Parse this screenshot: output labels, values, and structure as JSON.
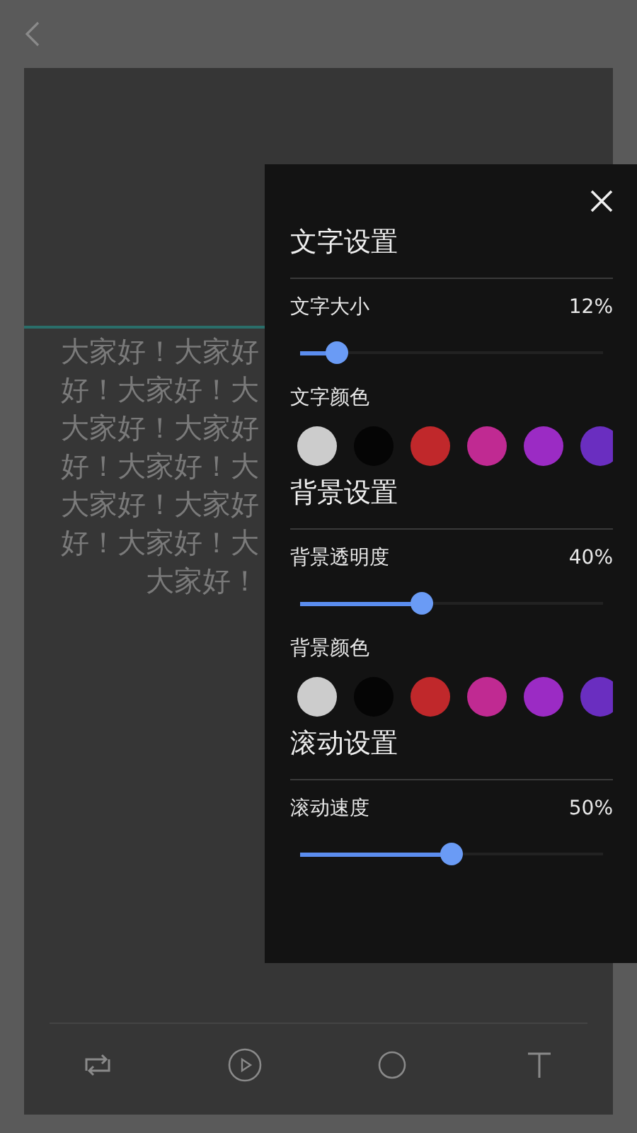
{
  "marquee": {
    "lines": [
      "大家好！大家好",
      "好！大家好！大",
      "大家好！大家好",
      "好！大家好！大",
      "大家好！大家好",
      "好！大家好！大",
      "大家好！"
    ]
  },
  "settings_panel": {
    "sections": [
      {
        "title": "文字设置",
        "rows": [
          {
            "kind": "slider",
            "label": "文字大小",
            "reading": "12%",
            "level": 0.12
          },
          {
            "kind": "swatches",
            "label": "文字颜色",
            "swatches": [
              {
                "color": "#cccccc"
              },
              {
                "color": "#050505"
              },
              {
                "color": "#c0282b"
              },
              {
                "color": "#c02a92"
              },
              {
                "color": "#9b2bc4"
              },
              {
                "color": "#6a2ec0"
              }
            ]
          }
        ]
      },
      {
        "title": "背景设置",
        "rows": [
          {
            "kind": "slider",
            "label": "背景透明度",
            "reading": "40%",
            "level": 0.4
          },
          {
            "kind": "swatches",
            "label": "背景颜色",
            "swatches": [
              {
                "color": "#cccccc"
              },
              {
                "color": "#050505"
              },
              {
                "color": "#c0282b"
              },
              {
                "color": "#c02a92"
              },
              {
                "color": "#9b2bc4"
              },
              {
                "color": "#6a2ec0"
              }
            ]
          }
        ]
      },
      {
        "title": "滚动设置",
        "rows": [
          {
            "kind": "slider",
            "label": "滚动速度",
            "reading": "50%",
            "level": 0.5
          }
        ]
      }
    ]
  }
}
